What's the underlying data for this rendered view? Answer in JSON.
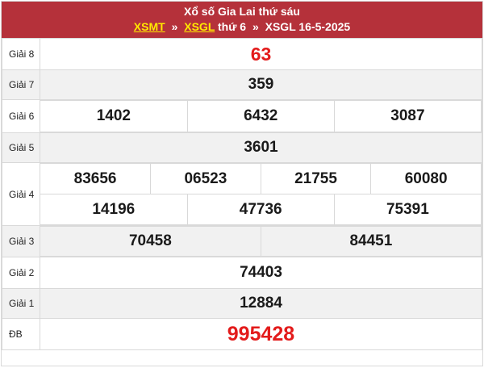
{
  "header": {
    "title": "Xổ số Gia Lai thứ sáu",
    "crumb_1": "XSMT",
    "separator": "»",
    "crumb_2": "XSGL",
    "crumb_3_prefix": "thứ 6",
    "crumb_4": "XSGL 16-5-2025"
  },
  "prizes": {
    "g8": {
      "label": "Giải 8",
      "numbers": [
        "63"
      ]
    },
    "g7": {
      "label": "Giải 7",
      "numbers": [
        "359"
      ]
    },
    "g6": {
      "label": "Giải 6",
      "numbers": [
        "1402",
        "6432",
        "3087"
      ]
    },
    "g5": {
      "label": "Giải 5",
      "numbers": [
        "3601"
      ]
    },
    "g4": {
      "label": "Giải 4",
      "numbers": [
        "83656",
        "06523",
        "21755",
        "60080",
        "14196",
        "47736",
        "75391"
      ]
    },
    "g3": {
      "label": "Giải 3",
      "numbers": [
        "70458",
        "84451"
      ]
    },
    "g2": {
      "label": "Giải 2",
      "numbers": [
        "74403"
      ]
    },
    "g1": {
      "label": "Giải 1",
      "numbers": [
        "12884"
      ]
    },
    "db": {
      "label": "ĐB",
      "numbers": [
        "995428"
      ]
    }
  },
  "colors": {
    "header_bg": "#b5313a",
    "link_yellow": "#ffe900",
    "highlight_red": "#e31b1b",
    "row_alt_bg": "#f1f1f1"
  }
}
